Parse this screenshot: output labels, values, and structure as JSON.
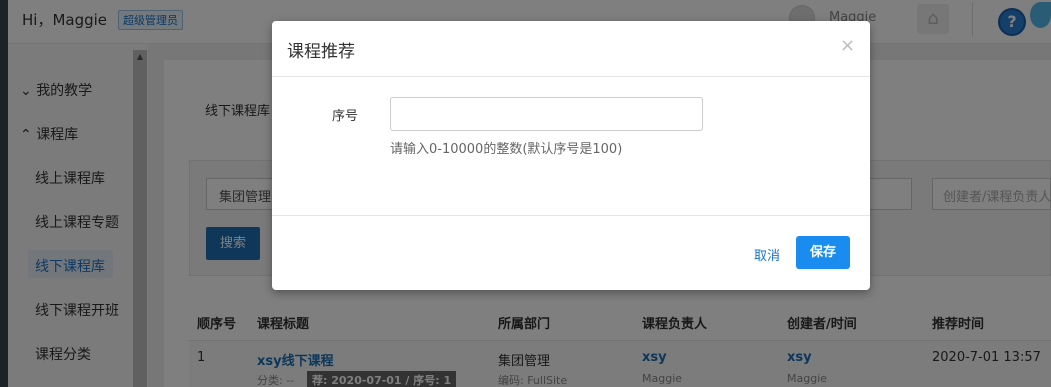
{
  "header": {
    "greeting": "Hi，Maggie",
    "role_badge": "超级管理员",
    "user_name": "Maggie",
    "help_label": "?"
  },
  "sidebar": {
    "items": [
      {
        "label": "我的教学",
        "chevron": "⌄"
      },
      {
        "label": "课程库",
        "chevron": "⌃"
      }
    ],
    "sub_items": [
      {
        "label": "线上课程库"
      },
      {
        "label": "线上课程专题"
      },
      {
        "label": "线下课程库"
      },
      {
        "label": "线下课程开班"
      },
      {
        "label": "课程分类"
      }
    ]
  },
  "main": {
    "tab_label": "线下课程库",
    "filter": {
      "department_value": "集团管理",
      "creator_placeholder": "创建者/课程负责人"
    },
    "search_label": "搜索",
    "table": {
      "headers": [
        "顺序号",
        "课程标题",
        "所属部门",
        "课程负责人",
        "创建者/时间",
        "推荐时间"
      ],
      "rows": [
        {
          "order": "1",
          "title": "xsy线下课程",
          "category": "分类: --",
          "recommend_tag": "荐: 2020-07-01 / 序号: 1",
          "department": "集团管理",
          "code": "编码: FullSite",
          "owner": "xsy",
          "owner_sub": "Maggie",
          "creator": "xsy",
          "creator_sub": "Maggie",
          "recommend_time": "2020-7-01 13:57"
        }
      ]
    }
  },
  "modal": {
    "title": "课程推荐",
    "close": "×",
    "field_label": "序号",
    "field_value": "",
    "help_text": "请输入0-10000的整数(默认序号是100)",
    "cancel_label": "取消",
    "save_label": "保存"
  },
  "colors": {
    "primary": "#1a8cf0",
    "link": "#1a73c7",
    "overlay": "rgba(0,0,0,0.5)"
  }
}
